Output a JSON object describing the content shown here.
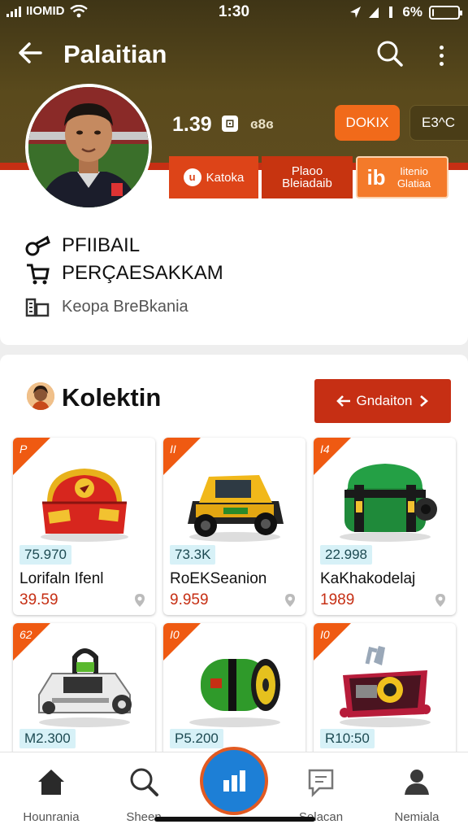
{
  "status_bar": {
    "time": "1:30",
    "carrier": "IIOMID",
    "battery": "6%",
    "battery_level": 0.06
  },
  "header": {
    "title": "Palaitian",
    "back_icon": "back-arrow-icon",
    "search_icon": "search-icon",
    "menu_icon": "more-vert-icon"
  },
  "profile": {
    "stat_value": "1.39",
    "stat_badge": "⊡",
    "stat_sub": "ɞ8ɞ",
    "primary_button": "DOKIX",
    "secondary_button": "E3^C",
    "actions": [
      {
        "label": "Katoka",
        "icon": "u"
      },
      {
        "label": "Plaoo Bleiadaib"
      },
      {
        "label": "Iitenio Glatiaa",
        "icon": "ib"
      }
    ],
    "name": "PFIIBAIL",
    "subtitle": "PERÇAESAKKAM",
    "location": "Keopa BreBkania"
  },
  "collection": {
    "title": "Kolektin",
    "button_label": "Gndaiton",
    "cards": [
      {
        "tag": "P",
        "code": "75.970",
        "name": "Lorifaln Ifenl",
        "price": "39.59",
        "product": "red-case"
      },
      {
        "tag": "II",
        "code": "73.3K",
        "name": "RoEKSeanion",
        "price": "9.959",
        "product": "yellow-robot"
      },
      {
        "tag": "I4",
        "code": "22.998",
        "name": "KaKhakodelaj",
        "price": "1989",
        "product": "green-case"
      },
      {
        "tag": "62",
        "code": "M2.300",
        "name": "",
        "price": "",
        "product": "white-vacuum"
      },
      {
        "tag": "I0",
        "code": "P5.200",
        "name": "",
        "price": "",
        "product": "green-drum"
      },
      {
        "tag": "I0",
        "code": "R10:50",
        "name": "",
        "price": "",
        "product": "red-kit"
      }
    ]
  },
  "bottom_nav": {
    "items": [
      {
        "label": "Hounrania",
        "icon": "home-icon"
      },
      {
        "label": "Sheen",
        "icon": "search-icon"
      },
      {
        "label": "Selacan",
        "icon": "chat-icon"
      },
      {
        "label": "Nemiala",
        "icon": "person-icon"
      }
    ],
    "center_icon": "chart-icon"
  },
  "colors": {
    "header": "#4a3e18",
    "accent": "#c62f14",
    "orange": "#f16a1a",
    "center_blue": "#1d7fd6"
  }
}
